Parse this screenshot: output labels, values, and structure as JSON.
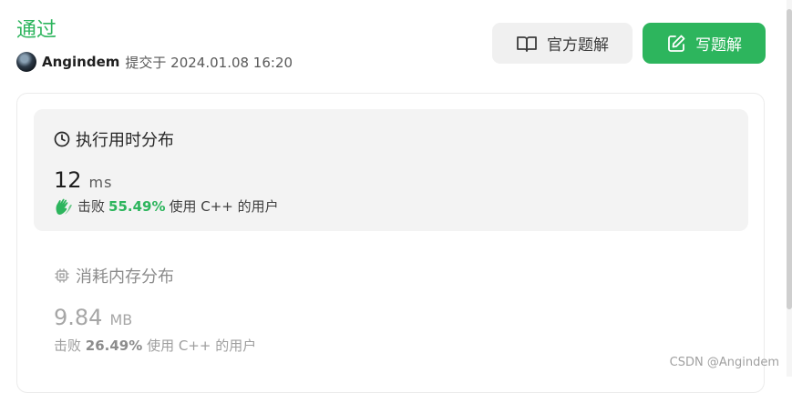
{
  "header": {
    "status": "通过",
    "username": "Angindem",
    "submitted_text": "提交于 2024.01.08 16:20",
    "official_solution_label": "官方题解",
    "write_solution_label": "写题解"
  },
  "runtime": {
    "title": "执行用时分布",
    "value": "12",
    "unit": "ms",
    "beats_prefix": "击败",
    "beats_pct": "55.49%",
    "beats_suffix": "使用 C++ 的用户"
  },
  "memory": {
    "title": "消耗内存分布",
    "value": "9.84",
    "unit": "MB",
    "beats_prefix": "击败",
    "beats_pct": "26.49%",
    "beats_suffix": "使用 C++ 的用户"
  },
  "watermark": "CSDN @Angindem",
  "colors": {
    "accent": "#2db55d",
    "panel": "#f3f3f3"
  },
  "icons": [
    "book-icon",
    "edit-icon",
    "clock-icon",
    "clap-icon",
    "chip-icon"
  ]
}
